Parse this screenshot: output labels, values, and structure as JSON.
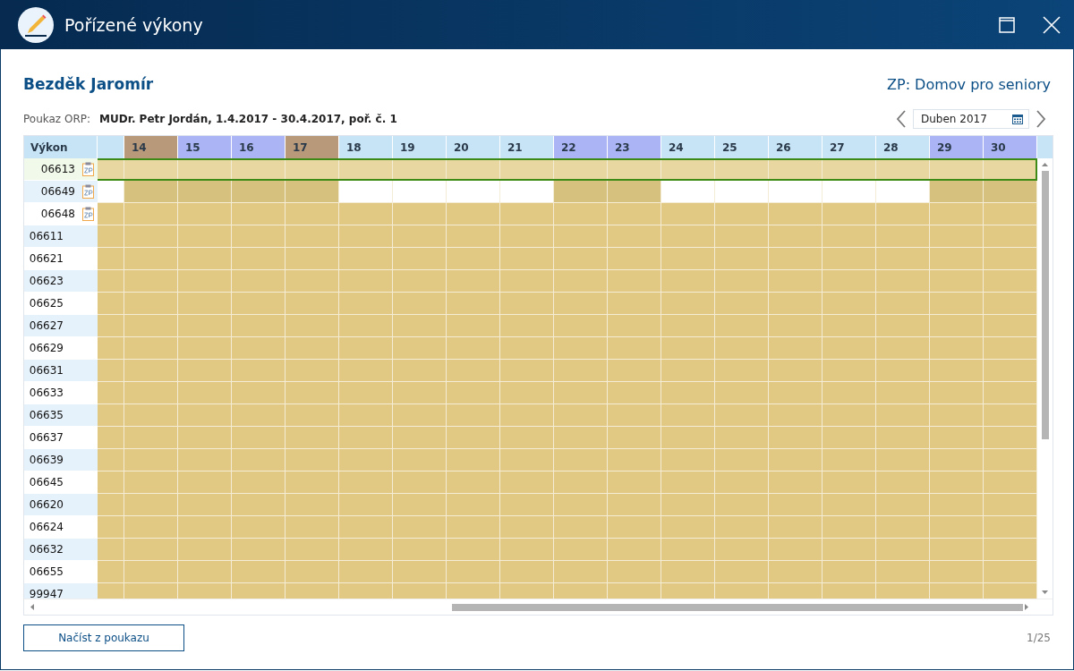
{
  "window": {
    "title": "Pořízené výkony"
  },
  "patient": {
    "name": "Bezděk Jaromír",
    "insurer": "ZP: Domov pro seniory"
  },
  "referral": {
    "label": "Poukaz ORP:",
    "value": "MUDr. Petr Jordán, 1.4.2017 - 30.4.2017, poř. č. 1"
  },
  "month_picker": {
    "value": "Duben 2017"
  },
  "grid": {
    "corner": "Výkon",
    "days": [
      {
        "kind": "workday"
      },
      {
        "label": "14",
        "kind": "holiday"
      },
      {
        "label": "15",
        "kind": "weekend"
      },
      {
        "label": "16",
        "kind": "weekend"
      },
      {
        "label": "17",
        "kind": "holiday"
      },
      {
        "label": "18",
        "kind": "workday"
      },
      {
        "label": "19",
        "kind": "workday"
      },
      {
        "label": "20",
        "kind": "workday"
      },
      {
        "label": "21",
        "kind": "workday"
      },
      {
        "label": "22",
        "kind": "weekend"
      },
      {
        "label": "23",
        "kind": "weekend"
      },
      {
        "label": "24",
        "kind": "workday"
      },
      {
        "label": "25",
        "kind": "workday"
      },
      {
        "label": "26",
        "kind": "workday"
      },
      {
        "label": "27",
        "kind": "workday"
      },
      {
        "label": "28",
        "kind": "workday"
      },
      {
        "label": "29",
        "kind": "weekend"
      },
      {
        "label": "30",
        "kind": "weekend"
      }
    ],
    "rows": [
      {
        "code": "06613",
        "zp": true,
        "selected": true
      },
      {
        "code": "06649",
        "zp": true,
        "selected": false,
        "cells": [
          {
            "closed": false
          },
          {
            "closed": true
          },
          {
            "closed": true
          },
          {
            "closed": true
          },
          {
            "closed": true
          },
          {
            "closed": false
          },
          {
            "closed": false
          },
          {
            "closed": false
          },
          {
            "closed": false
          },
          {
            "closed": true
          },
          {
            "closed": true
          },
          {
            "closed": false
          },
          {
            "closed": false
          },
          {
            "closed": false
          },
          {
            "closed": false
          },
          {
            "closed": false
          },
          {
            "closed": true
          },
          {
            "closed": true
          }
        ]
      },
      {
        "code": "06648",
        "zp": true,
        "selected": false
      },
      {
        "code": "06611",
        "zp": false,
        "selected": false
      },
      {
        "code": "06621",
        "zp": false,
        "selected": false
      },
      {
        "code": "06623",
        "zp": false,
        "selected": false
      },
      {
        "code": "06625",
        "zp": false,
        "selected": false
      },
      {
        "code": "06627",
        "zp": false,
        "selected": false
      },
      {
        "code": "06629",
        "zp": false,
        "selected": false
      },
      {
        "code": "06631",
        "zp": false,
        "selected": false
      },
      {
        "code": "06633",
        "zp": false,
        "selected": false
      },
      {
        "code": "06635",
        "zp": false,
        "selected": false
      },
      {
        "code": "06637",
        "zp": false,
        "selected": false
      },
      {
        "code": "06639",
        "zp": false,
        "selected": false
      },
      {
        "code": "06645",
        "zp": false,
        "selected": false
      },
      {
        "code": "06620",
        "zp": false,
        "selected": false
      },
      {
        "code": "06624",
        "zp": false,
        "selected": false
      },
      {
        "code": "06632",
        "zp": false,
        "selected": false
      },
      {
        "code": "06655",
        "zp": false,
        "selected": false
      },
      {
        "code": "99947",
        "zp": false,
        "selected": false
      }
    ]
  },
  "footer": {
    "button": "Načíst z poukazu",
    "counter": "1/25"
  }
}
